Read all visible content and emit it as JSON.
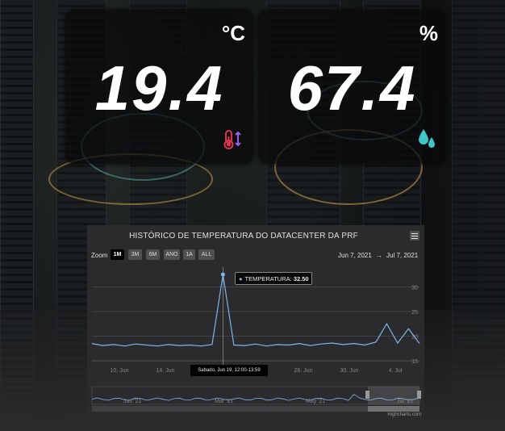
{
  "temperature": {
    "value": "19.4",
    "unit": "°C",
    "icon": "thermometer-icon"
  },
  "humidity": {
    "value": "67.4",
    "unit": "%",
    "icon": "water-drops-icon"
  },
  "chart": {
    "title": "HISTÓRICO DE TEMPERATURA DO DATACENTER DA PRF",
    "zoom_label": "Zoom",
    "zoom_buttons": [
      "1M",
      "3M",
      "6M",
      "ANO",
      "1A",
      "ALL"
    ],
    "range_from": "Jun 7, 2021",
    "range_sep": "→",
    "range_to": "Jul 7, 2021",
    "tooltip_series": "TEMPERATURA:",
    "tooltip_value": "32.50",
    "crosshair_label": "Sabado, Jun 19, 12:00-13:59",
    "credits": "Highcharts.com",
    "colors": {
      "series": "#7cb5ec",
      "background": "#2b2b2d"
    }
  },
  "chart_data": {
    "type": "line",
    "series": [
      {
        "name": "TEMPERATURA",
        "x": [
          0,
          1,
          2,
          3,
          4,
          5,
          6,
          7,
          8,
          9,
          10,
          11,
          12,
          13,
          14,
          15,
          16,
          17,
          18,
          19,
          20,
          21,
          22,
          23,
          24,
          25,
          26,
          27,
          28,
          29,
          30
        ],
        "values": [
          18.5,
          18.1,
          18.3,
          18.0,
          18.4,
          18.2,
          18.0,
          18.3,
          18.1,
          18.2,
          18.0,
          18.3,
          32.5,
          18.2,
          18.1,
          18.4,
          18.0,
          18.3,
          18.2,
          18.5,
          18.1,
          18.4,
          18.6,
          18.3,
          18.5,
          18.2,
          18.8,
          22.5,
          18.6,
          21.5,
          18.5
        ]
      }
    ],
    "x_ticks": [
      "10. Jun",
      "14. Jun",
      "18. Jun",
      "22. Jun",
      "26. Jun",
      "30. Jun",
      "4. Jul"
    ],
    "y_ticks": [
      "15",
      "20",
      "25",
      "30"
    ],
    "ylim": [
      15,
      34
    ],
    "navigator_labels": [
      "Jan '21",
      "Mar '21",
      "May '21",
      "Jul '21"
    ]
  }
}
